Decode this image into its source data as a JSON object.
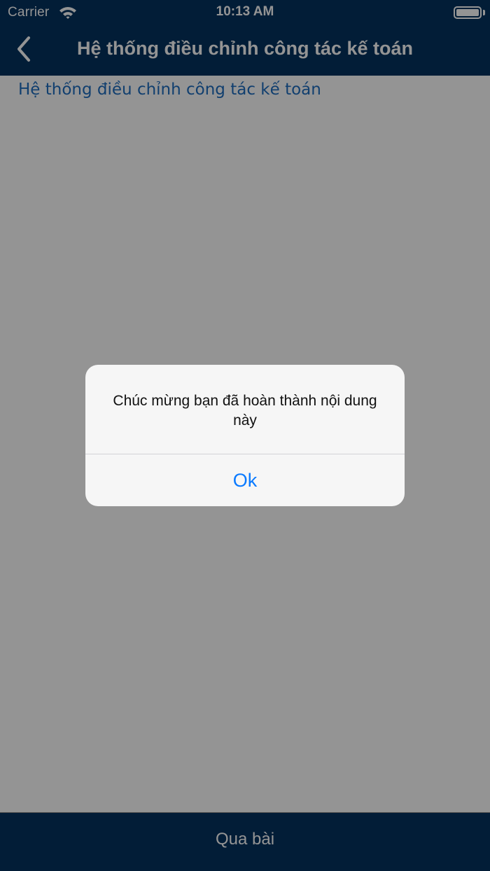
{
  "status_bar": {
    "carrier": "Carrier",
    "time": "10:13 AM",
    "icons": [
      "wifi-icon",
      "battery-icon"
    ]
  },
  "nav_bar": {
    "back_icon": "chevron-left-icon",
    "title": "Hệ thống điều chỉnh công tác kế toán"
  },
  "content": {
    "heading": "Hệ thống điều chỉnh công tác kế toán"
  },
  "bottom_bar": {
    "next_label": "Qua bài"
  },
  "alert": {
    "message": "Chúc mừng bạn đã hoàn thành nội dung này",
    "ok_label": "Ok"
  },
  "colors": {
    "nav_background": "#053360",
    "link_blue": "#1e6dbf",
    "alert_button": "#0a7aff",
    "overlay": "rgba(0,0,0,0.42)"
  }
}
